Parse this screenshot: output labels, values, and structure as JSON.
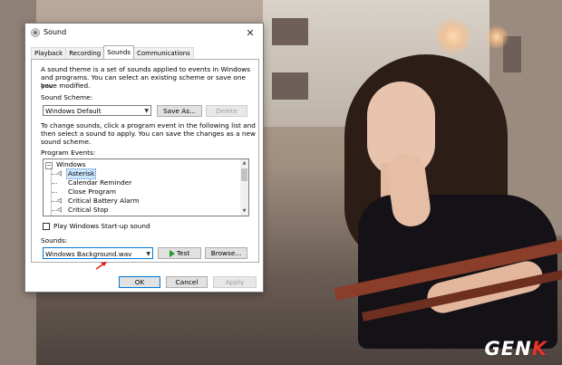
{
  "window": {
    "title": "Sound",
    "close_label": "✕"
  },
  "tabs": [
    {
      "label": "Playback"
    },
    {
      "label": "Recording"
    },
    {
      "label": "Sounds"
    },
    {
      "label": "Communications"
    }
  ],
  "sounds": {
    "intro_line1": "A sound theme is a set of sounds applied to events in Windows",
    "intro_line2": "and programs.  You can select an existing scheme or save one you",
    "intro_line3": "have modified.",
    "scheme_label": "Sound Scheme:",
    "scheme_value": "Windows Default",
    "save_as_label": "Save As...",
    "delete_label": "Delete",
    "help_line1": "To change sounds, click a program event in the following list and",
    "help_line2": "then select a sound to apply.  You can save the changes as a new",
    "help_line3": "sound scheme.",
    "events_label": "Program Events:",
    "events_root": "Windows",
    "events": [
      {
        "label": "Asterisk",
        "selected": true,
        "has_sound": true
      },
      {
        "label": "Calendar Reminder",
        "selected": false,
        "has_sound": false
      },
      {
        "label": "Close Program",
        "selected": false,
        "has_sound": false
      },
      {
        "label": "Critical Battery Alarm",
        "selected": false,
        "has_sound": true
      },
      {
        "label": "Critical Stop",
        "selected": false,
        "has_sound": true
      }
    ],
    "startup_checkbox_label": "Play Windows Start-up sound",
    "startup_checked": false,
    "sounds_label": "Sounds:",
    "sound_value": "Windows Background.wav",
    "test_label": "Test",
    "browse_label": "Browse..."
  },
  "footer": {
    "ok_label": "OK",
    "cancel_label": "Cancel",
    "apply_label": "Apply"
  },
  "watermark": {
    "text_main": "GEN",
    "text_accent": "K"
  },
  "colors": {
    "accent": "#0078d7",
    "selection": "#cce8ff",
    "test_icon": "#1e9e28",
    "annotation_arrow": "#e0201a",
    "watermark_accent": "#e8322a"
  }
}
